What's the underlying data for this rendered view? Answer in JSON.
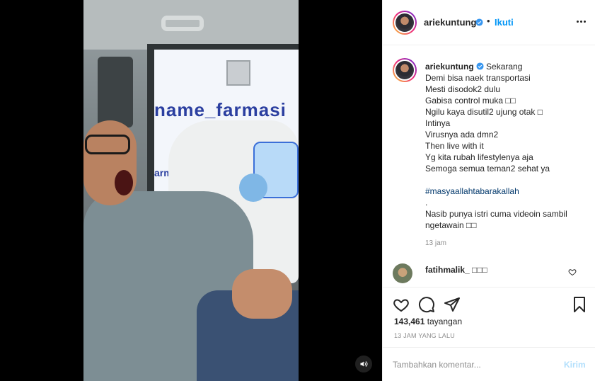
{
  "post": {
    "username": "ariekuntung",
    "dot": "•",
    "follow_label": "Ikuti",
    "caption": {
      "username": "ariekuntung",
      "time_inline": "Sekarang",
      "lines": [
        "Demi bisa naek transportasi",
        "Mesti disodok2 dulu",
        "Gabisa control muka □□",
        "Ngilu kaya disutil2 ujung otak □",
        "Intinya",
        "Virusnya ada dmn2",
        "Then live with it",
        "Yg kita rubah lifestylenya aja",
        "Semoga semua teman2 sehat ya"
      ],
      "hashtag": "#masyaallahtabarakallah",
      "dot_line": ".",
      "closing_lines": [
        "Nasib punya istri cuma videoin sambil",
        "ngetawain □□"
      ],
      "timestamp": "13 jam"
    },
    "comment": {
      "username": "fatihmalik_",
      "text": "□□□"
    },
    "views_count": "143,461",
    "views_label": "tayangan",
    "post_age": "13 JAM YANG LALU",
    "comment_placeholder": "Tambahkan komentar...",
    "post_label": "Kirim"
  },
  "video": {
    "banner_text": "name_farmasi",
    "banner_text2": "armasi"
  },
  "colors": {
    "link": "#0095f6",
    "hashtag": "#00376b",
    "muted": "#8e8e8e",
    "post_disabled": "#b2dffc"
  },
  "icons": [
    "more-options-icon",
    "verified-icon",
    "heart-icon",
    "comment-icon",
    "share-icon",
    "bookmark-icon",
    "volume-icon"
  ]
}
